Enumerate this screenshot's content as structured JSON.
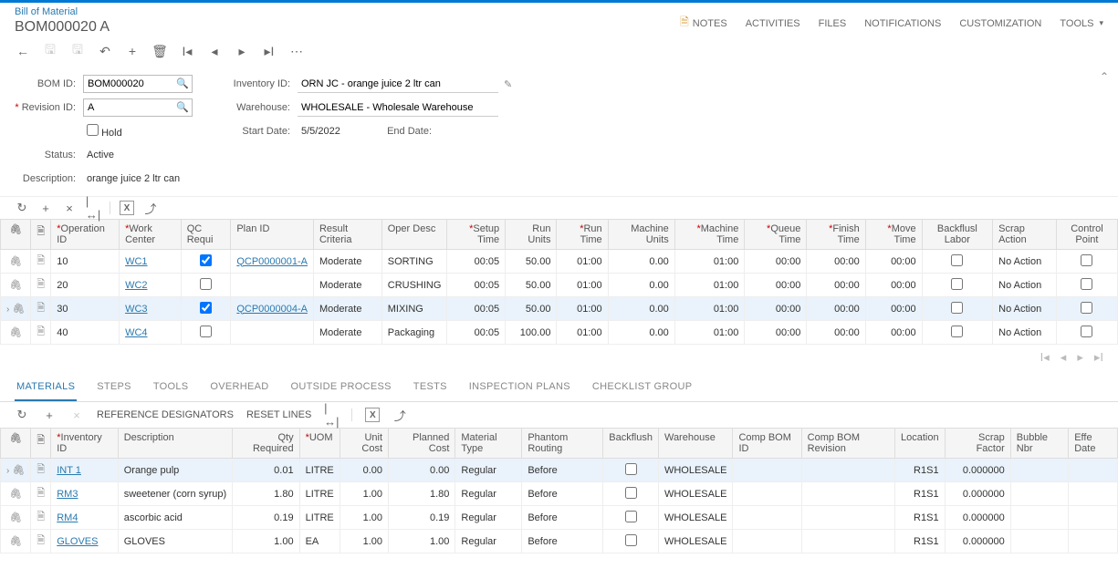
{
  "breadcrumb": "Bill of Material",
  "title": "BOM000020 A",
  "header_links": {
    "notes": "NOTES",
    "activities": "ACTIVITIES",
    "files": "FILES",
    "notifications": "NOTIFICATIONS",
    "customization": "CUSTOMIZATION",
    "tools": "TOOLS"
  },
  "form": {
    "labels": {
      "bom_id": "BOM ID:",
      "revision_id": "Revision ID:",
      "hold": "Hold",
      "status": "Status:",
      "description": "Description:",
      "inventory_id": "Inventory ID:",
      "warehouse": "Warehouse:",
      "start_date": "Start Date:",
      "end_date": "End Date:"
    },
    "values": {
      "bom_id": "BOM000020",
      "revision_id": "A",
      "status": "Active",
      "description": "orange juice 2 ltr can",
      "inventory_id": "ORN JC - orange juice 2 ltr can",
      "warehouse": "WHOLESALE - Wholesale Warehouse",
      "start_date": "5/5/2022",
      "end_date": ""
    }
  },
  "ops_columns": {
    "operation_id": "Operation ID",
    "work_center": "Work Center",
    "qc_requi": "QC Requi",
    "plan_id": "Plan ID",
    "result_criteria": "Result Criteria",
    "oper_desc": "Oper Desc",
    "setup_time": "Setup Time",
    "run_units": "Run Units",
    "run_time": "Run Time",
    "machine_units": "Machine Units",
    "machine_time": "Machine Time",
    "queue_time": "Queue Time",
    "finish_time": "Finish Time",
    "move_time": "Move Time",
    "backflush_labor": "Backflusl Labor",
    "scrap_action": "Scrap Action",
    "control_point": "Control Point"
  },
  "ops": [
    {
      "id": "10",
      "wc": "WC1",
      "qc": true,
      "plan": "QCP0000001-A",
      "result": "Moderate",
      "desc": "SORTING",
      "setup": "00:05",
      "rununits": "50.00",
      "runtime": "01:00",
      "munits": "0.00",
      "mtime": "01:00",
      "queue": "00:00",
      "finish": "00:00",
      "move": "00:00",
      "backflush": false,
      "scrap": "No Action",
      "cp": false,
      "selected": false
    },
    {
      "id": "20",
      "wc": "WC2",
      "qc": false,
      "plan": "",
      "result": "Moderate",
      "desc": "CRUSHING",
      "setup": "00:05",
      "rununits": "50.00",
      "runtime": "01:00",
      "munits": "0.00",
      "mtime": "01:00",
      "queue": "00:00",
      "finish": "00:00",
      "move": "00:00",
      "backflush": false,
      "scrap": "No Action",
      "cp": false,
      "selected": false
    },
    {
      "id": "30",
      "wc": "WC3",
      "qc": true,
      "plan": "QCP0000004-A",
      "result": "Moderate",
      "desc": "MIXING",
      "setup": "00:05",
      "rununits": "50.00",
      "runtime": "01:00",
      "munits": "0.00",
      "mtime": "01:00",
      "queue": "00:00",
      "finish": "00:00",
      "move": "00:00",
      "backflush": false,
      "scrap": "No Action",
      "cp": false,
      "selected": true
    },
    {
      "id": "40",
      "wc": "WC4",
      "qc": false,
      "plan": "",
      "result": "Moderate",
      "desc": "Packaging",
      "setup": "00:05",
      "rununits": "100.00",
      "runtime": "01:00",
      "munits": "0.00",
      "mtime": "01:00",
      "queue": "00:00",
      "finish": "00:00",
      "move": "00:00",
      "backflush": false,
      "scrap": "No Action",
      "cp": false,
      "selected": false
    }
  ],
  "tabs": {
    "materials": "MATERIALS",
    "steps": "STEPS",
    "tools": "TOOLS",
    "overhead": "OVERHEAD",
    "outside": "OUTSIDE PROCESS",
    "tests": "TESTS",
    "inspection": "INSPECTION PLANS",
    "checklist": "CHECKLIST GROUP"
  },
  "sub_buttons": {
    "reference": "REFERENCE DESIGNATORS",
    "reset": "RESET LINES"
  },
  "mat_columns": {
    "inventory_id": "Inventory ID",
    "description": "Description",
    "qty_required": "Qty Required",
    "uom": "UOM",
    "unit_cost": "Unit Cost",
    "planned_cost": "Planned Cost",
    "material_type": "Material Type",
    "phantom_routing": "Phantom Routing",
    "backflush": "Backflush",
    "warehouse": "Warehouse",
    "comp_bom_id": "Comp BOM ID",
    "comp_bom_rev": "Comp BOM Revision",
    "location": "Location",
    "scrap_factor": "Scrap Factor",
    "bubble_nbr": "Bubble Nbr",
    "eff_date": "Effe Date"
  },
  "materials": [
    {
      "inv": "INT 1",
      "desc": "Orange pulp",
      "qty": "0.01",
      "uom": "LITRE",
      "unit": "0.00",
      "planned": "0.00",
      "type": "Regular",
      "phantom": "Before",
      "backflush": false,
      "wh": "WHOLESALE",
      "compbom": "",
      "comprev": "",
      "loc": "R1S1",
      "scrap": "0.000000",
      "bubble": "",
      "selected": true
    },
    {
      "inv": "RM3",
      "desc": "sweetener (corn syrup)",
      "qty": "1.80",
      "uom": "LITRE",
      "unit": "1.00",
      "planned": "1.80",
      "type": "Regular",
      "phantom": "Before",
      "backflush": false,
      "wh": "WHOLESALE",
      "compbom": "",
      "comprev": "",
      "loc": "R1S1",
      "scrap": "0.000000",
      "bubble": "",
      "selected": false
    },
    {
      "inv": "RM4",
      "desc": "ascorbic acid",
      "qty": "0.19",
      "uom": "LITRE",
      "unit": "1.00",
      "planned": "0.19",
      "type": "Regular",
      "phantom": "Before",
      "backflush": false,
      "wh": "WHOLESALE",
      "compbom": "",
      "comprev": "",
      "loc": "R1S1",
      "scrap": "0.000000",
      "bubble": "",
      "selected": false
    },
    {
      "inv": "GLOVES",
      "desc": "GLOVES",
      "qty": "1.00",
      "uom": "EA",
      "unit": "1.00",
      "planned": "1.00",
      "type": "Regular",
      "phantom": "Before",
      "backflush": false,
      "wh": "WHOLESALE",
      "compbom": "",
      "comprev": "",
      "loc": "R1S1",
      "scrap": "0.000000",
      "bubble": "",
      "selected": false
    }
  ]
}
